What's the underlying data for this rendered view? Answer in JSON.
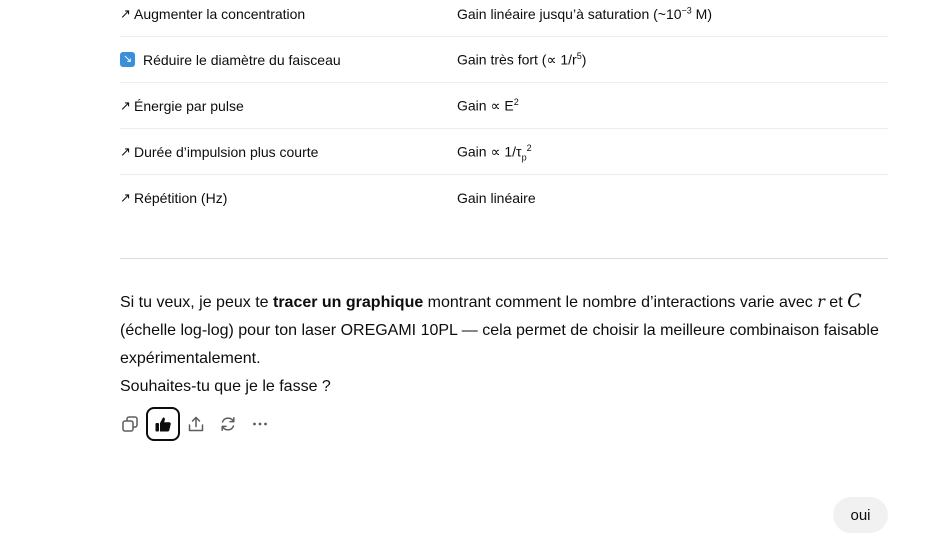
{
  "table": {
    "rows": [
      {
        "icon": "↗",
        "icon_name": "arrow-up-right-icon",
        "action": "Augmenter la concentration",
        "effect_prefix": "Gain linéaire jusqu’à saturation (~10",
        "effect_sup": "−3",
        "effect_suffix": " M)"
      },
      {
        "icon": "↘",
        "icon_name": "arrow-down-right-emoji-icon",
        "action": "Réduire le diamètre du faisceau",
        "effect_prefix": "Gain très fort (∝ 1/r",
        "effect_sup": "5",
        "effect_suffix": ")"
      },
      {
        "icon": "↗",
        "icon_name": "arrow-up-right-icon",
        "action": "Énergie par pulse",
        "effect_prefix": "Gain ∝ E",
        "effect_sup": "2",
        "effect_suffix": ""
      },
      {
        "icon": "↗",
        "icon_name": "arrow-up-right-icon",
        "action": "Durée d’impulsion plus courte",
        "effect_prefix": "Gain ∝ 1/τ",
        "effect_sub": "p",
        "effect_sup": "2",
        "effect_suffix": ""
      },
      {
        "icon": "↗",
        "icon_name": "arrow-up-right-icon",
        "action": "Répétition (Hz)",
        "effect_prefix": "Gain linéaire",
        "effect_sup": "",
        "effect_suffix": ""
      }
    ]
  },
  "message": {
    "intro": "Si tu veux, je peux te ",
    "bold": "tracer un graphique",
    "middle": " montrant comment le nombre d’interactions varie avec ",
    "var_r": "r",
    "and": " et ",
    "var_c": "C",
    "rest": " (échelle log-log) pour ton laser OREGAMI 10PL — cela permet de choisir la meilleure combinaison faisable expérimentalement.",
    "question": "Souhaites-tu que je le fasse ?"
  },
  "actions": {
    "copy": "copy-icon",
    "thumbs_up": "thumbs-up-icon",
    "share": "share-icon",
    "regenerate": "regenerate-icon",
    "more": "more-icon"
  },
  "user_reply": "oui",
  "colors": {
    "emoji_blue": "#3b8fd9",
    "bubble_bg": "#f1f1f1",
    "text": "#0d0d0d"
  }
}
